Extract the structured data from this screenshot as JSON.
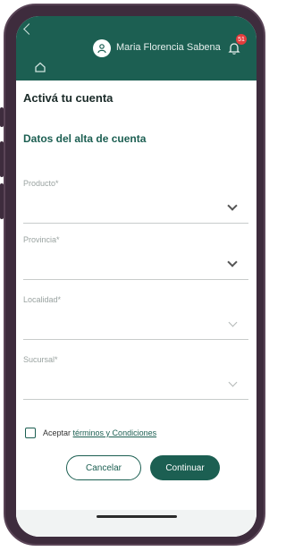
{
  "header": {
    "user_name": "Maria Florencia Sabena",
    "notification_count": "51",
    "accent": "#1c5f52"
  },
  "page": {
    "title": "Activá tu cuenta",
    "section_title": "Datos del alta de cuenta"
  },
  "form": {
    "fields": [
      {
        "label": "Producto*",
        "icon": "chevron-down-icon"
      },
      {
        "label": "Provincia*",
        "icon": "chevron-down-icon"
      },
      {
        "label": "Localidad*",
        "icon": "chevron-down-icon"
      },
      {
        "label": "Sucursal*",
        "icon": "chevron-down-icon"
      }
    ],
    "terms_prefix": "Aceptar",
    "terms_link": "términos y Condiciones"
  },
  "actions": {
    "cancel_label": "Cancelar",
    "continue_label": "Continuar"
  }
}
